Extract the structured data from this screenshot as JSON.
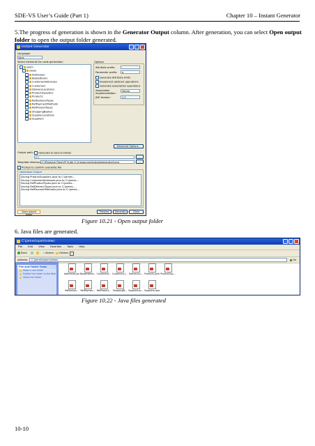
{
  "header": {
    "left": "SDE-VS User’s Guide (Part 1)",
    "right": "Chapter 10 – Instant Generator"
  },
  "step5": {
    "number": "5.",
    "text_a": "The progress of generation is shown in the ",
    "bold_a": "Generator Output",
    "text_b": " column. After generation, you can select ",
    "bold_b": "Open output folder",
    "text_c": " to open the output folder generated."
  },
  "dialog": {
    "title": "Instant Generator",
    "language_label": "Language:",
    "language_value": "Java",
    "select_label": "Select elements for code generation",
    "tree": [
      "vpsm",
      "views",
      "Addresses",
      "BasketItems",
      "CustomerAddresses",
      "Customers",
      "DeliveryLocations",
      "ProductSuppliers",
      "Products",
      "RefDeliveryTypes",
      "RefPaymentMethods",
      "RefProductTypes",
      "ShoppingBasket",
      "SupplierLocations",
      "Suppliers"
    ],
    "options_label": "Options",
    "attr_prefix_label": "Attribute prefix:",
    "param_prefix_label": "Parameter prefix:",
    "param_prefix_value": "a",
    "opt1": "Generate Attribute Hints",
    "opt2": "Implement abstract operations",
    "opt3": "Generate association operations",
    "assoc_label": "Association implementation:",
    "assoc_value": "Vector",
    "jdk_label": "JDK Version:",
    "jdk_value": "1.5",
    "advanced_button": "Advanced Options...",
    "output_path_label": "Output path:",
    "generate_source_folder": "Generate to Source Folder",
    "output_path_value": "C:\\",
    "template_label": "Template directory:",
    "template_value": "C:\\Program Files\\VP Suite 3.1\\resources\\instantgenerator\\java",
    "prompt_label": "Prompt to confirm overwrite file",
    "gen_output_label": "Generator Output",
    "log": [
      "Saving ProductSuppliers.java to C:\\james...",
      "Saving CustomerAddresses.java to C:\\james...",
      "Saving RefProductTypes.java to C:\\james...",
      "Saving RefDeliveryTypes.java to C:\\james...",
      "Saving RefPaymentMethods.java to C:\\james..."
    ],
    "open_output_button": "Open output folder",
    "preview_button": "Preview",
    "generate_button": "Generate",
    "close_button": "Close"
  },
  "figure1_caption": "Figure 10.21 - Open output folder",
  "step6": "6. Java files are generated.",
  "explorer": {
    "title": "C:\\james\\vpsm\\views",
    "menu": [
      "File",
      "Edit",
      "View",
      "Favorites",
      "Tools",
      "Help"
    ],
    "back_label": "Back",
    "search_label": "Search",
    "folders_label": "Folders",
    "address_label": "Address",
    "address_value": "C:\\james\\vpsm\\views",
    "go_label": "Go",
    "tasks_header": "File and Folder Tasks",
    "tasks": [
      "Make a new folder",
      "Publish this folder to the Web",
      "Share this folder"
    ],
    "files_row1": [
      "Addresses.java",
      "BasketItems...",
      "CustomerA...",
      "Customers.j...",
      "DeliveryLo...",
      "Products.java",
      "ProductSup..."
    ],
    "files_row2": [
      "RefDeliver...",
      "RefPaymen...",
      "RefProduct...",
      "ShoppingB...",
      "SupplierLoc...",
      "Suppliers.java"
    ]
  },
  "figure2_caption": "Figure 10.22 - Java files generated",
  "footer": "10-10"
}
